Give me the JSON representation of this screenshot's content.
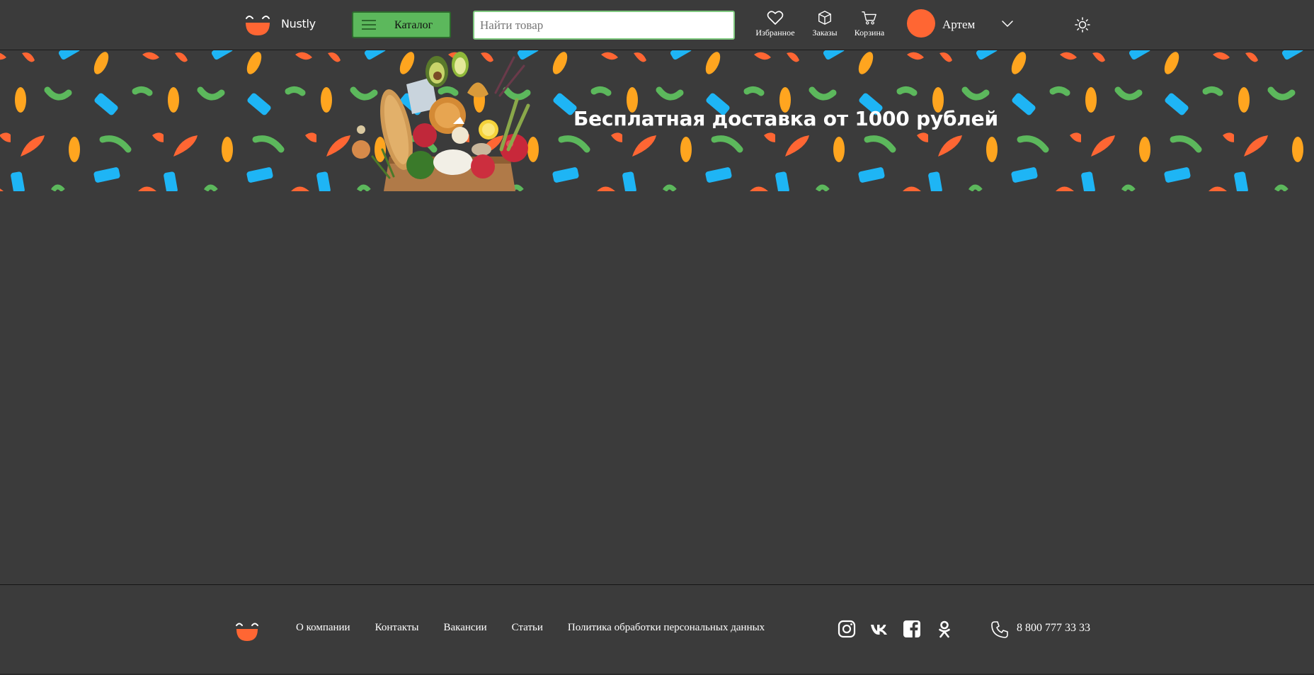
{
  "header": {
    "brand": "Nustly",
    "catalog_label": "Каталог",
    "search_placeholder": "Найти товар",
    "nav": {
      "favorites": "Избранное",
      "orders": "Заказы",
      "cart": "Корзина"
    },
    "user_name": "Артем"
  },
  "banner": {
    "title": "Бесплатная доставка от 1000 рублей"
  },
  "footer": {
    "links": [
      "О компании",
      "Контакты",
      "Вакансии",
      "Статьи",
      "Политика обработки персональных данных"
    ],
    "socials": [
      "instagram-icon",
      "vk-icon",
      "facebook-icon",
      "odnoklassniki-icon"
    ],
    "phone": "8 800 777 33 33"
  },
  "colors": {
    "background": "#3b3b3b",
    "accent_green": "#5cb85c",
    "accent_orange": "#ff6633",
    "pattern_yellow": "#ffa51f",
    "pattern_blue": "#1eb5f5",
    "pattern_green": "#5cb85c"
  }
}
